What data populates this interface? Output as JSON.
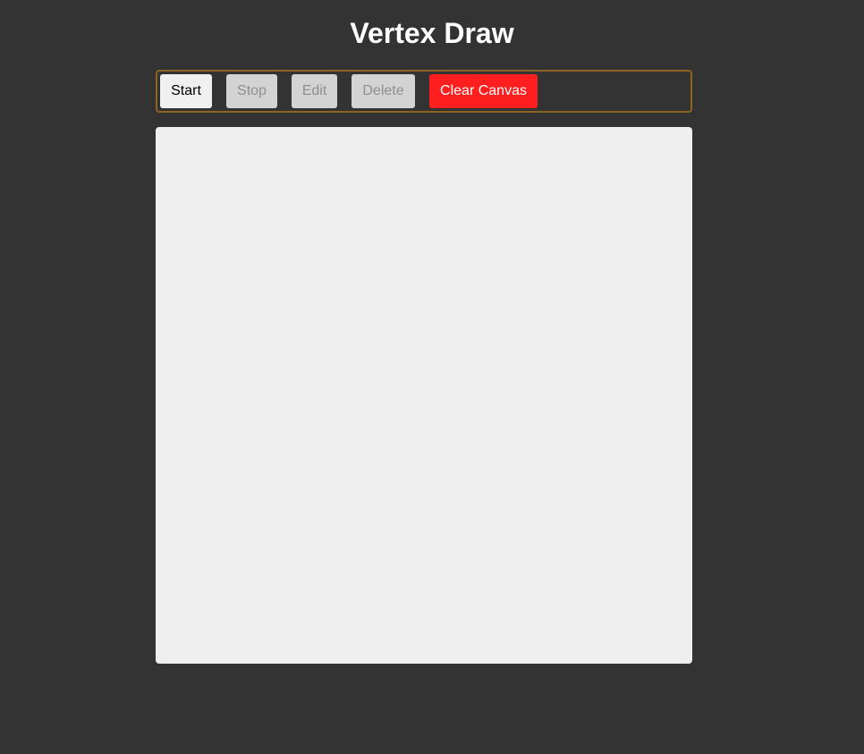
{
  "header": {
    "title": "Vertex Draw"
  },
  "toolbar": {
    "start_label": "Start",
    "stop_label": "Stop",
    "edit_label": "Edit",
    "delete_label": "Delete",
    "clear_label": "Clear Canvas",
    "disabled": [
      "Stop",
      "Edit",
      "Delete"
    ]
  },
  "colors": {
    "background": "#333333",
    "toolbar_border": "#8b6420",
    "clear_button": "#ff1f1f",
    "canvas": "#efefef"
  }
}
